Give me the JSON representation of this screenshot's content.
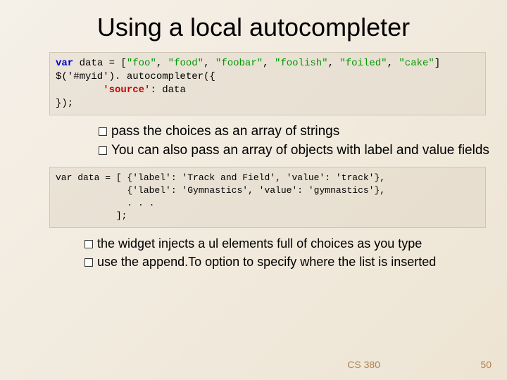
{
  "title": "Using a local autocompleter",
  "code1": {
    "l1a": "var",
    "l1b": " data = [",
    "l1c": "\"foo\"",
    "l1d": ", ",
    "l1e": "\"food\"",
    "l1f": ", ",
    "l1g": "\"foobar\"",
    "l1h": ", ",
    "l1i": "\"foolish\"",
    "l1j": ", ",
    "l1k": "\"foiled\"",
    "l1l": ", ",
    "l1m": "\"cake\"",
    "l1n": "]",
    "l2": "$('#myid'). autocompleter({",
    "indent": "        ",
    "k1": "'source'",
    "sep": ": data",
    "l4": "});"
  },
  "bullets1": [
    "pass the choices as an array of strings",
    "You can also pass an array of objects with label and value fields"
  ],
  "code2": {
    "l1": "var data = [ {",
    "kl1": "'label'",
    "c1": ": 'Track and Field', ",
    "kv1": "'value'",
    "c1b": ": 'track'},",
    "pad2": "             {",
    "kl2": "'label'",
    "c2": ": 'Gymnastics', ",
    "kv2": "'value'",
    "c2b": ": 'gymnastics'},",
    "l3": "             . . .",
    "l4": "           ];"
  },
  "bullets2": [
    "the widget injects a ul elements full of choices as you type",
    "use the append.To option to specify where the list is inserted"
  ],
  "footer": {
    "course": "CS 380",
    "page": "50"
  }
}
